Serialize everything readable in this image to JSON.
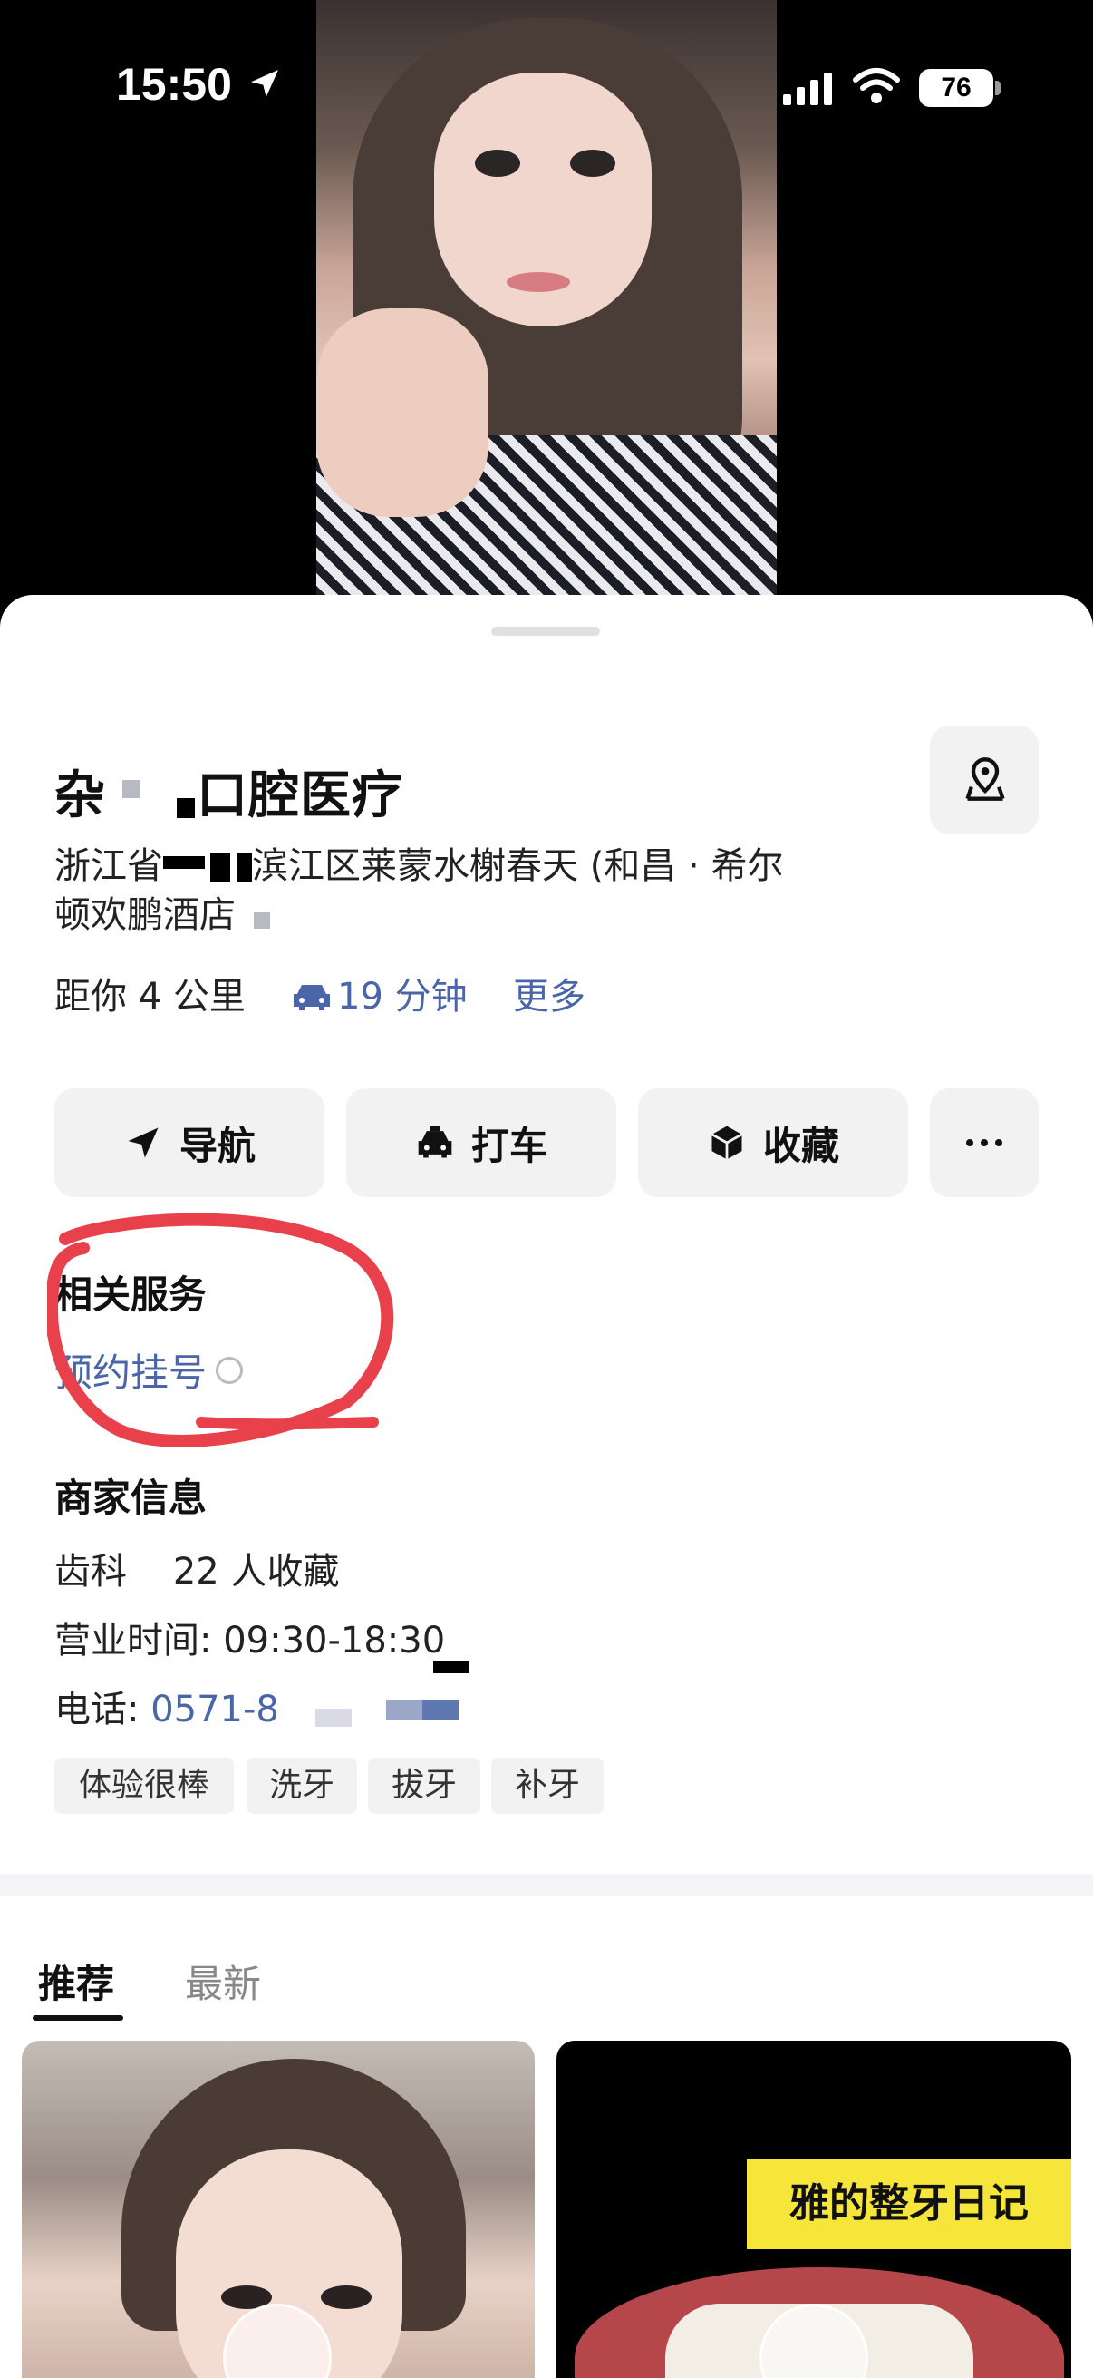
{
  "status_bar": {
    "time": "15:50",
    "battery": "76"
  },
  "poi": {
    "title_parts": [
      "杂",
      "口腔医疗"
    ],
    "address_parts": [
      "浙江省",
      "滨江区莱蒙水榭春天 (和昌 · 希尔",
      "顿欢鹏酒店"
    ],
    "distance": "距你 4 公里",
    "drive_time": "19 分钟",
    "more": "更多"
  },
  "actions": {
    "navigate": "导航",
    "taxi": "打车",
    "favorite": "收藏"
  },
  "related": {
    "title": "相关服务",
    "booking": "预约挂号"
  },
  "merchant": {
    "title": "商家信息",
    "category": "齿科",
    "favorites": "22 人收藏",
    "hours": "营业时间: 09:30-18:30",
    "phone_label": "电话: ",
    "phone_visible": "0571-8",
    "tags": [
      "体验很棒",
      "洗牙",
      "拔牙",
      "补牙"
    ]
  },
  "feed": {
    "tabs": [
      "推荐",
      "最新"
    ],
    "cards": [
      {
        "caption": ""
      },
      {
        "caption": "雅的整牙日记"
      }
    ]
  },
  "colors": {
    "link": "#4a66a8",
    "annotation": "#e8414b",
    "caption_bg": "#f6e63a"
  }
}
